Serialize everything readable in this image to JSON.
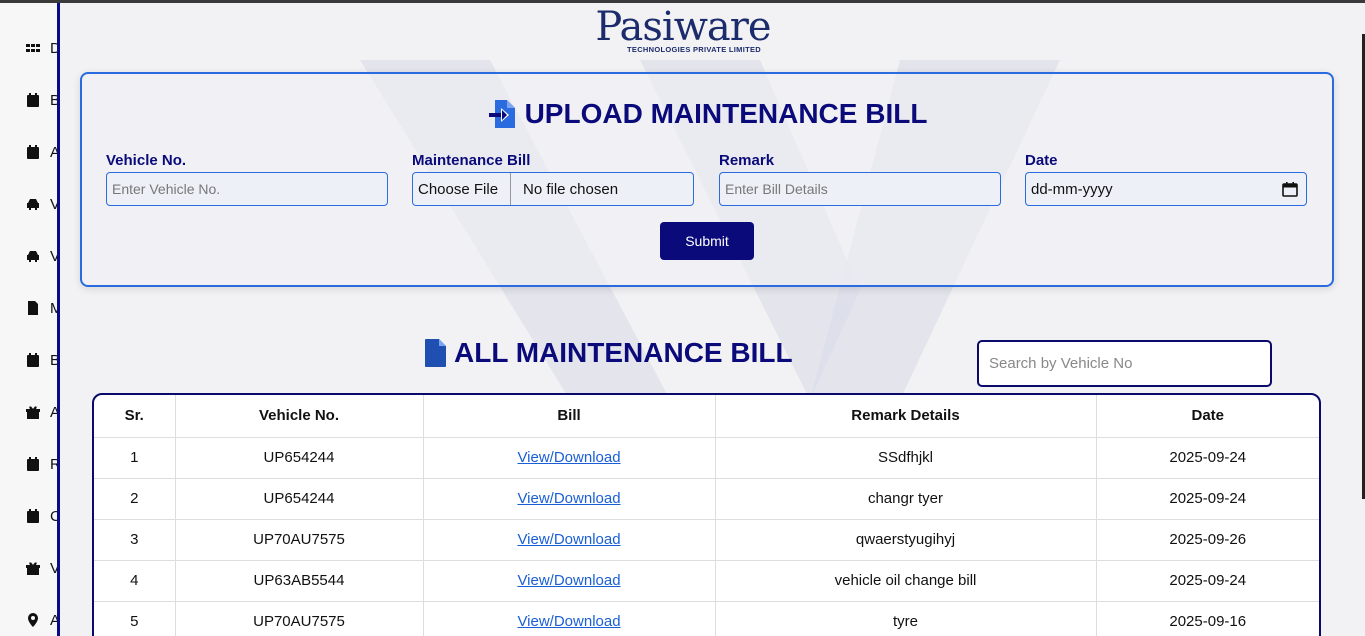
{
  "logo": {
    "main": "Pasiware",
    "sub": "TECHNOLOGIES PRIVATE LIMITED"
  },
  "sidebar": {
    "items": [
      {
        "label": "D",
        "icon": "grid-icon"
      },
      {
        "label": "B",
        "icon": "calendar-icon"
      },
      {
        "label": "A",
        "icon": "calendar-icon"
      },
      {
        "label": "V",
        "icon": "car-icon"
      },
      {
        "label": "V",
        "icon": "car-icon"
      },
      {
        "label": "M",
        "icon": "file-icon"
      },
      {
        "label": "B",
        "icon": "calendar-icon"
      },
      {
        "label": "A",
        "icon": "gift-icon"
      },
      {
        "label": "R",
        "icon": "calendar-icon"
      },
      {
        "label": "C",
        "icon": "calendar-icon"
      },
      {
        "label": "V",
        "icon": "gift-icon"
      },
      {
        "label": "A",
        "icon": "location-pin-icon"
      }
    ]
  },
  "upload": {
    "title": "UPLOAD MAINTENANCE BILL",
    "vehicle_label": "Vehicle No.",
    "vehicle_placeholder": "Enter Vehicle No.",
    "bill_label": "Maintenance Bill",
    "choose_file": "Choose File",
    "no_file": "No file chosen",
    "remark_label": "Remark",
    "remark_placeholder": "Enter Bill Details",
    "date_label": "Date",
    "date_placeholder": "dd-mm-yyyy",
    "submit": "Submit"
  },
  "list": {
    "title": "ALL MAINTENANCE BILL",
    "search_placeholder": "Search by  Vehicle No",
    "columns": [
      "Sr.",
      "Vehicle No.",
      "Bill",
      "Remark Details",
      "Date"
    ],
    "rows": [
      {
        "sr": "1",
        "vehicle": "UP654244",
        "bill": "View/Download",
        "remark": "SSdfhjkl",
        "date": "2025-09-24"
      },
      {
        "sr": "2",
        "vehicle": "UP654244",
        "bill": "View/Download",
        "remark": "changr tyer",
        "date": "2025-09-24"
      },
      {
        "sr": "3",
        "vehicle": "UP70AU7575",
        "bill": "View/Download",
        "remark": "qwaerstyugihyj",
        "date": "2025-09-26"
      },
      {
        "sr": "4",
        "vehicle": "UP63AB5544",
        "bill": "View/Download",
        "remark": "vehicle oil change bill",
        "date": "2025-09-24"
      },
      {
        "sr": "5",
        "vehicle": "UP70AU7575",
        "bill": "View/Download",
        "remark": "tyre",
        "date": "2025-09-16"
      }
    ]
  },
  "colors": {
    "brand_navy": "#0a0a7a",
    "accent_blue": "#2a6be0",
    "link_blue": "#1a5fd6"
  }
}
